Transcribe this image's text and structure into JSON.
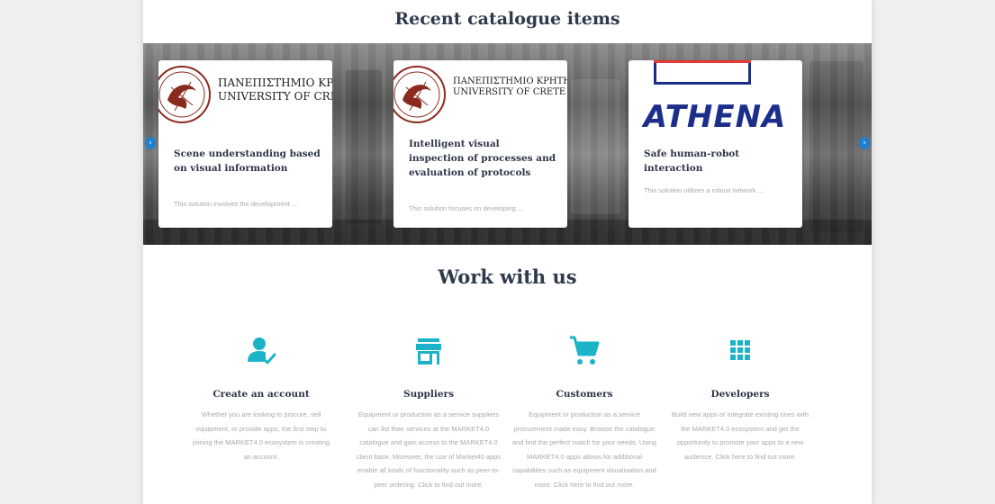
{
  "recent": {
    "title": "Recent catalogue items",
    "prev_arrow": "‹",
    "next_arrow": "›",
    "cards": [
      {
        "logo_lines": [
          "ΠΑΝΕΠΙΣΤΗΜΙΟ ΚΡΗΤΗ",
          "UNIVERSITY OF CRETE"
        ],
        "title": "Scene understanding based on visual information",
        "description": "This solution involves the development ..."
      },
      {
        "logo_lines": [
          "ΠΑΝΕΠΙΣΤΗΜΙΟ ΚΡΗΤΗ",
          "UNIVERSITY OF CRETE"
        ],
        "title": "Intelligent visual inspection of processes and evaluation of protocols",
        "description": "This solution focuses on developing ..."
      },
      {
        "logo_text": "ATHENA",
        "title": "Safe human-robot interaction",
        "description": "This solution utilizes a robust network ..."
      }
    ]
  },
  "work": {
    "title": "Work with us",
    "accent_color": "#1bb3c8",
    "items": [
      {
        "icon": "user-check-icon",
        "title": "Create an account",
        "text": "Whether you are looking to procure, sell equipment, or provide apps, the first step to joining the MARKET4.0 ecosystem is creating an account."
      },
      {
        "icon": "store-icon",
        "title": "Suppliers",
        "text": "Equipment or production as a service suppliers can list their services at the MARKET4.0 catalogue and gain access to the MARKET4.0 client base. Moreover, the use of Market40 apps enable all kinds of functionality such as peer-to-peer ordering. Click to find out more."
      },
      {
        "icon": "cart-icon",
        "title": "Customers",
        "text": "Equipment or production as a service procurement made easy. Browse the catalogue and find the perfect match for your needs. Using MARKET4.0 apps allows for additional capabilities such as equipment visualisation and more. Click here to find out more."
      },
      {
        "icon": "apps-grid-icon",
        "title": "Developers",
        "text": "Build new apps or integrate existing ones with the MARKET4.0 ecosystem and get the opportunity to promote your apps to a new audience. Click here to find out more."
      }
    ]
  }
}
